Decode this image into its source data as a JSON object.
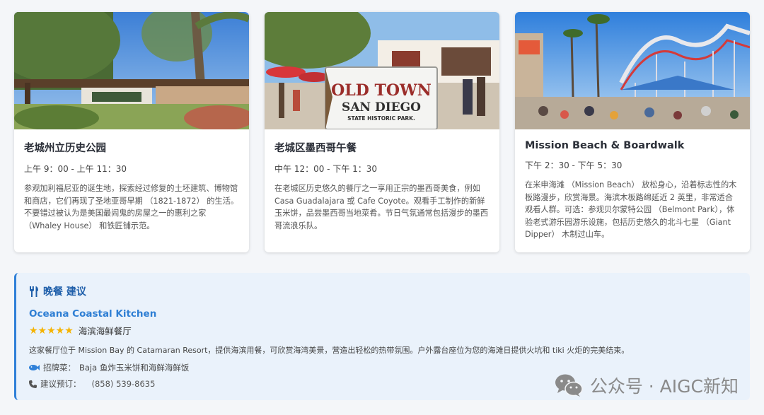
{
  "cards": [
    {
      "title": "老城州立历史公园",
      "time": "上午 9：00 - 上午 11：30",
      "description": "参观加利福尼亚的诞生地，探索经过修复的土坯建筑、博物馆和商店，它们再现了圣地亚哥早期 （1821-1872） 的生活。不要错过被认为是美国最闹鬼的房屋之一的惠利之家 （Whaley House） 和铁匠铺示范。"
    },
    {
      "title": "老城区墨西哥午餐",
      "time": "中午 12：00 - 下午 1：30",
      "description": "在老城区历史悠久的餐厅之一享用正宗的墨西哥美食，例如 Casa Guadalajara 或 Cafe Coyote。观看手工制作的新鲜玉米饼，品尝墨西哥当地菜肴。节日气氛通常包括漫步的墨西哥流浪乐队。",
      "sign_line1": "OLD TOWN",
      "sign_line2": "SAN DIEGO",
      "sign_line3": "STATE HISTORIC PARK."
    },
    {
      "title": "Mission Beach & Boardwalk",
      "time": "下午 2：30 - 下午 5：30",
      "description": "在米申海滩 （Mission Beach） 放松身心，沿着标志性的木板路漫步，欣赏海景。海滨木板路绵延近 2 英里，非常适合观看人群。可选：参观贝尔蒙特公园 （Belmont Park），体验老式游乐园游乐设施，包括历史悠久的北斗七星 （Giant Dipper） 木制过山车。"
    }
  ],
  "dinner": {
    "heading": "晚餐 建议",
    "heading_icon": "utensils-icon",
    "restaurant_name": "Oceana Coastal Kitchen",
    "stars": "★★★★★",
    "rating": 5,
    "cuisine": "海滨海鲜餐厅",
    "description": "这家餐厅位于 Mission Bay 的 Catamaran Resort，提供海滨用餐，可欣赏海湾美景，营造出轻松的热带氛围。户外露台座位为您的海滩日提供火坑和 tiki 火炬的完美结束。",
    "signature_label": "招牌菜：",
    "signature_value": "Baja 鱼炸玉米饼和海鲜海鲜饭",
    "phone_label": "建议预订：",
    "phone_value": "(858) 539-8635",
    "accent_color": "#2f80d8"
  },
  "watermark": {
    "text": "公众号 · AIGC新知",
    "icon": "wechat-icon"
  }
}
